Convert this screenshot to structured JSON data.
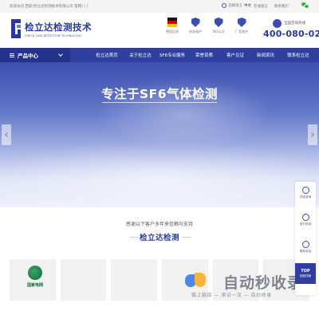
{
  "topbar": {
    "welcome": "欢迎访问 西安(检立达检测技术有限公司 官网) ( )",
    "language_label": "选择语言",
    "language_value": "中文",
    "links": [
      "在线留言",
      "联系我们"
    ],
    "wechat_icon": "wechat-icon"
  },
  "header": {
    "logo_cn": "检立达检测技术",
    "logo_en": "CHECK LIDA DETECTION TECHNOLOGY",
    "badges": [
      {
        "label": "德国品质",
        "icon": "germany-flag-icon"
      },
      {
        "label": "终身维护",
        "icon": "shield-icon"
      },
      {
        "label": "ISO认证",
        "icon": "shield-icon"
      },
      {
        "label": "厂家直供",
        "icon": "shield-icon"
      }
    ],
    "hotline_label": "全国咨询热线",
    "hotline_number": "400-080-0239"
  },
  "nav": {
    "products": "产品中心",
    "items": [
      "检立达首页",
      "关于检立达",
      "SF6专业服务",
      "荣誉资质",
      "客户见证",
      "新闻资讯",
      "联系检立达"
    ]
  },
  "banner": {
    "headline": "专注于SF6气体检测"
  },
  "section": {
    "subtitle": "感谢以下客户多年来信赖与支持",
    "title": "检立达检测"
  },
  "clients": [
    {
      "name": "国家电网"
    },
    {
      "name": ""
    },
    {
      "name": ""
    },
    {
      "name": ""
    },
    {
      "name": ""
    },
    {
      "name": ""
    }
  ],
  "sidebar": {
    "items": [
      "在线咨询",
      "官方热线",
      "联系电话"
    ],
    "top_label": "TOP",
    "top_sub": "回到顶部"
  },
  "watermark": {
    "brand": "自动秒收录",
    "slogan": "做上链接 — 来访一次 — 自动收录"
  },
  "colors": {
    "brand_blue": "#2f3f9e",
    "accent_dark": "#2a3a9b"
  }
}
